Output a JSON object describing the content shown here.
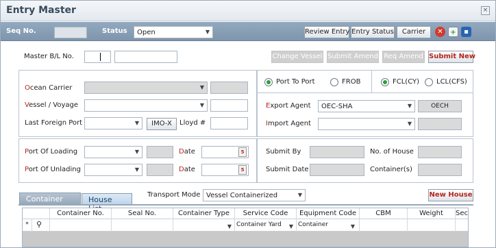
{
  "window": {
    "title": "Entry Master",
    "close_glyph": "×"
  },
  "toolbar": {
    "seq_no_label": "Seq No.",
    "status_label": "Status",
    "status_value": "Open",
    "review_entry": "Review Entry",
    "entry_status": "Entry Status",
    "carrier": "Carrier"
  },
  "master": {
    "bl_label": "Master B/L No.",
    "change_vessel": "Change Vessel",
    "submit_amend": "Submit Amend",
    "req_amend": "Req Amend",
    "submit_new": "Submit New"
  },
  "carrier_panel": {
    "ocean_carrier_first": "O",
    "ocean_carrier_rest": "cean Carrier",
    "vessel_first": "V",
    "vessel_rest": "essel / Voyage",
    "last_foreign_port": "Last Foreign Port",
    "imo_x": "IMO-X",
    "lloyd": "Lloyd #"
  },
  "route_panel": {
    "port_to_port": "Port To Port",
    "frob": "FROB",
    "fcl": "FCL(CY)",
    "lcl": "LCL(CFS)",
    "export_agent_first": "E",
    "export_agent_rest": "xport Agent",
    "export_agent_value": "OEC-SHA",
    "export_agent_code": "OECH",
    "import_agent_first": "I",
    "import_agent_rest": "mport Agent"
  },
  "ports_panel": {
    "loading_first": "P",
    "loading_rest": "ort Of Loading",
    "unlading_first": "P",
    "unlading_rest": "ort Of Unlading",
    "date_first": "D",
    "date_rest": "ate",
    "cal_glyph": "5"
  },
  "submit_panel": {
    "submit_by": "Submit By",
    "no_of_house": "No. of House",
    "submit_date": "Submit Date",
    "containers": "Container(s)"
  },
  "tabs": {
    "container_list": "Container List",
    "house_list": "House List",
    "transport_mode_label": "Transport Mode",
    "transport_mode_value": "Vessel Containerized",
    "new_house": "New House"
  },
  "grid": {
    "columns": [
      "Container No.",
      "Seal No.",
      "Container Type",
      "Service Code",
      "Equipment Code",
      "CBM",
      "Weight",
      "Sec"
    ],
    "filter_row": {
      "marker": "*",
      "service_code": "Container Yard",
      "equipment_code": "Container"
    }
  },
  "colors": {
    "accent_bar": "#8ba1b8",
    "required_red": "#b3261e",
    "radio_green": "#2f9d3a"
  }
}
